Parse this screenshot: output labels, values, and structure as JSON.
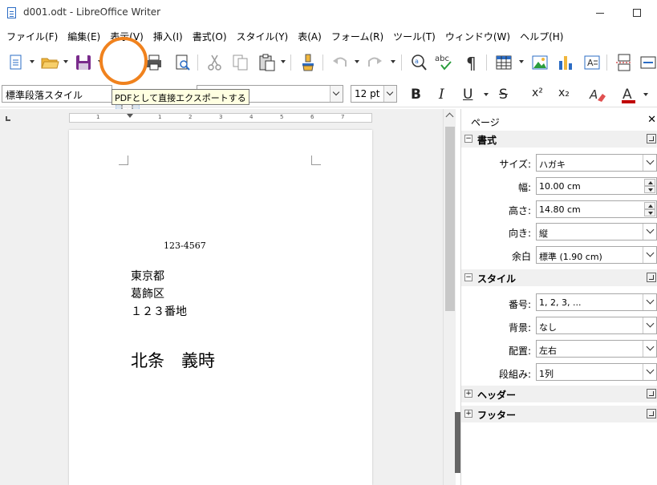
{
  "window": {
    "title": "d001.odt - LibreOffice Writer"
  },
  "menu": [
    "ファイル(F)",
    "編集(E)",
    "表示(V)",
    "挿入(I)",
    "書式(O)",
    "スタイル(Y)",
    "表(A)",
    "フォーム(R)",
    "ツール(T)",
    "ウィンドウ(W)",
    "ヘルプ(H)"
  ],
  "toolbar": {
    "tooltip": "PDFとして直接エクスポートする",
    "paragraph_style": "標準段落スタイル",
    "font_name": "",
    "font_size": "12 pt",
    "bold": "B",
    "italic": "I",
    "underline": "U",
    "strike": "S",
    "superscript": "x²",
    "subscript": "x₂",
    "highlight_color": "#f0821e",
    "font_color": "#c00000"
  },
  "document": {
    "postal_code": "123-4567",
    "address": [
      "東京都",
      "葛飾区",
      "１２３番地"
    ],
    "recipient": "北条　義時"
  },
  "ruler": [
    "1",
    "1",
    "2",
    "3",
    "4",
    "5",
    "6",
    "7"
  ],
  "sidebar": {
    "title": "ページ",
    "sections": {
      "format": {
        "title": "書式",
        "size_label": "サイズ:",
        "size_value": "ハガキ",
        "width_label": "幅:",
        "width_value": "10.00 cm",
        "height_label": "高さ:",
        "height_value": "14.80 cm",
        "orientation_label": "向き:",
        "orientation_value": "縦",
        "margin_label": "余白",
        "margin_value": "標準 (1.90 cm)"
      },
      "style": {
        "title": "スタイル",
        "number_label": "番号:",
        "number_value": "1, 2, 3, ...",
        "background_label": "背景:",
        "background_value": "なし",
        "layout_label": "配置:",
        "layout_value": "左右",
        "columns_label": "段組み:",
        "columns_value": "1列"
      },
      "header": {
        "title": "ヘッダー"
      },
      "footer": {
        "title": "フッター"
      }
    }
  }
}
